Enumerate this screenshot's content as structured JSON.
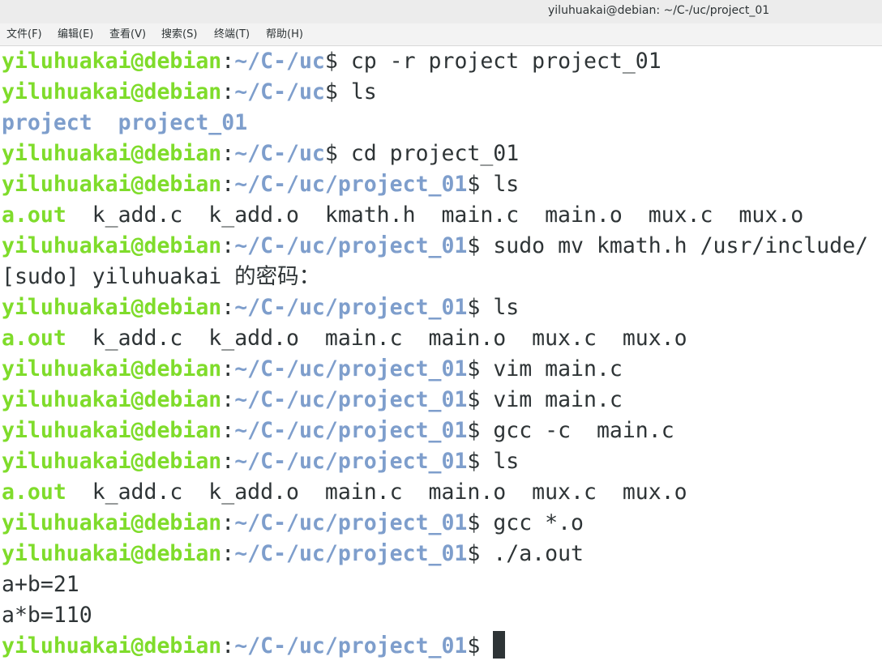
{
  "window": {
    "title": "yiluhuakai@debian: ~/C-/uc/project_01"
  },
  "menubar": {
    "items": [
      {
        "label": "文件(F)"
      },
      {
        "label": "编辑(E)"
      },
      {
        "label": "查看(V)"
      },
      {
        "label": "搜索(S)"
      },
      {
        "label": "终端(T)"
      },
      {
        "label": "帮助(H)"
      }
    ]
  },
  "prompt": {
    "user_host": "yiluhuakai@debian",
    "colon": ":",
    "path_uc": "~/C-/uc",
    "path_project": "~/C-/uc/project_01",
    "dollar": "$"
  },
  "lines": {
    "l0": {
      "cmd": " cp -r project project_01"
    },
    "l1": {
      "cmd": " ls"
    },
    "l2": {
      "dir1": "project",
      "sep": "  ",
      "dir2": "project_01"
    },
    "l3": {
      "cmd": " cd project_01"
    },
    "l4": {
      "cmd": " ls"
    },
    "l5": {
      "exec": "a.out",
      "rest": "  k_add.c  k_add.o  kmath.h  main.c  main.o  mux.c  mux.o"
    },
    "l6": {
      "cmd": " sudo mv kmath.h /usr/include/"
    },
    "l7": {
      "text": "[sudo] yiluhuakai 的密码："
    },
    "l8": {
      "cmd": " ls"
    },
    "l9": {
      "exec": "a.out",
      "rest": "  k_add.c  k_add.o  main.c  main.o  mux.c  mux.o"
    },
    "l10": {
      "cmd": " vim main.c"
    },
    "l11": {
      "cmd": " vim main.c"
    },
    "l12": {
      "cmd": " gcc -c  main.c"
    },
    "l13": {
      "cmd": " ls"
    },
    "l14": {
      "exec": "a.out",
      "rest": "  k_add.c  k_add.o  main.c  main.o  mux.c  mux.o"
    },
    "l15": {
      "cmd": " gcc *.o"
    },
    "l16": {
      "cmd": " ./a.out"
    },
    "l17": {
      "text": "a+b=21"
    },
    "l18": {
      "text": "a*b=110"
    },
    "l19": {
      "cmd": " "
    }
  },
  "colors": {
    "prompt_user": "#7fdc2b",
    "prompt_path": "#7e9ecc",
    "text": "#2e3436",
    "background": "#ffffff"
  }
}
